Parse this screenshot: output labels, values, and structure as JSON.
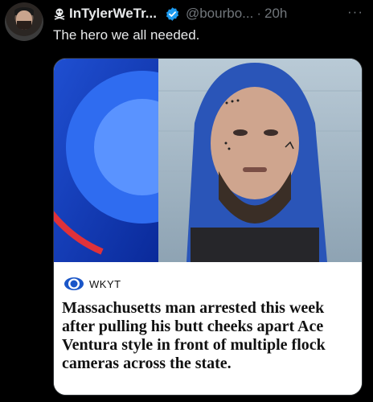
{
  "tweet": {
    "author_name": "InTylerWeTr...",
    "handle": "@bourbo...",
    "separator": "·",
    "time": "20h",
    "more": "···",
    "text": "The hero we all needed."
  },
  "media": {
    "station": "WKYT",
    "headline": "Massachusetts man arrested this week after pulling his butt cheeks apart Ace Ventura style in front of multiple flock cameras across the state."
  },
  "icons": {
    "author_prefix": "skull-crossbones-icon",
    "verified": "verified-badge-icon",
    "station_logo": "cbs-eye-icon"
  },
  "colors": {
    "verified": "#1d9bf0",
    "muted": "#71767b",
    "text": "#e7e9ea"
  }
}
